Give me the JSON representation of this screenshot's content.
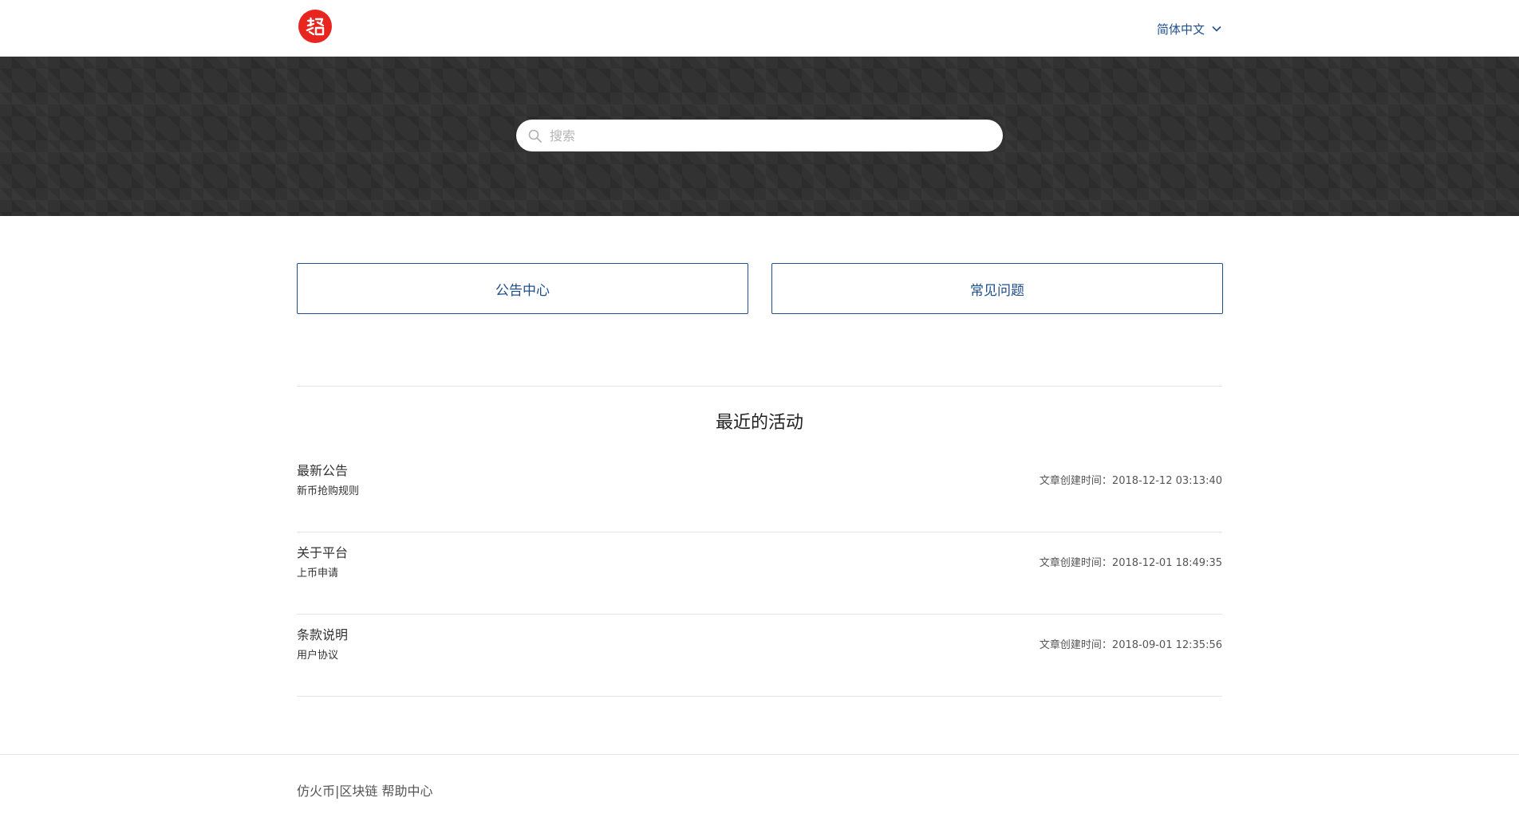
{
  "header": {
    "logo_icon": "brand-logo-icon",
    "language": "简体中文",
    "language_icon": "chevron-down-icon"
  },
  "search": {
    "placeholder": "搜索",
    "value": "",
    "icon": "search-icon"
  },
  "categories": [
    {
      "label": "公告中心"
    },
    {
      "label": "常见问题"
    }
  ],
  "recent": {
    "title": "最近的活动",
    "items": [
      {
        "category": "最新公告",
        "article": "新币抢购规则",
        "time": "文章创建时间：2018-12-12 03:13:40"
      },
      {
        "category": "关于平台",
        "article": "上币申请",
        "time": "文章创建时间：2018-12-01 18:49:35"
      },
      {
        "category": "条款说明",
        "article": "用户协议",
        "time": "文章创建时间：2018-09-01 12:35:56"
      }
    ]
  },
  "footer": {
    "text": "仿火币|区块链 帮助中心"
  },
  "colors": {
    "accent": "#1f4e8c",
    "logo": "#e8251f",
    "hero_bg": "#323232"
  }
}
